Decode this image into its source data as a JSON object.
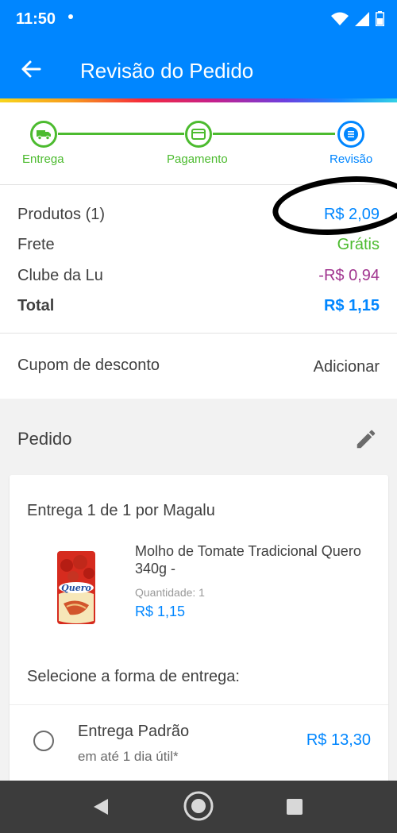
{
  "status": {
    "time": "11:50"
  },
  "appbar": {
    "title": "Revisão do Pedido"
  },
  "stepper": {
    "steps": [
      {
        "label": "Entrega"
      },
      {
        "label": "Pagamento"
      },
      {
        "label": "Revisão"
      }
    ]
  },
  "summary": {
    "produtos_label": "Produtos (1)",
    "produtos_value": "R$ 2,09",
    "frete_label": "Frete",
    "frete_value": "Grátis",
    "clube_label": "Clube da Lu",
    "clube_value": "-R$ 0,94",
    "total_label": "Total",
    "total_value": "R$ 1,15"
  },
  "colors": {
    "primary": "#0086ff",
    "success": "#4cbb2f",
    "discount": "#a1358f"
  },
  "coupon": {
    "label": "Cupom de desconto",
    "action": "Adicionar"
  },
  "pedido": {
    "heading": "Pedido",
    "entrega": "Entrega 1 de 1 por Magalu",
    "product": {
      "name": "Molho de Tomate Tradicional Quero 340g -",
      "qty": "Quantidade:  1",
      "price": "R$ 1,15",
      "image_brand": "Quero"
    },
    "select_heading": "Selecione a forma de entrega:",
    "option": {
      "name": "Entrega Padrão",
      "sub": "em até 1 dia útil*",
      "price": "R$ 13,30"
    }
  }
}
